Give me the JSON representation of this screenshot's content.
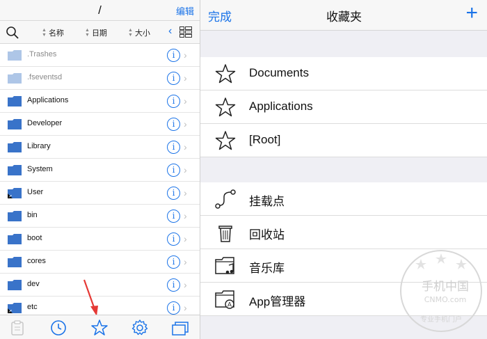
{
  "left": {
    "path": "/",
    "edit_label": "编辑",
    "sort": {
      "name": "名称",
      "date": "日期",
      "size": "大小"
    },
    "files": [
      {
        "name": ".Trashes",
        "dim": true
      },
      {
        "name": ".fseventsd",
        "dim": true
      },
      {
        "name": "Applications",
        "dim": false
      },
      {
        "name": "Developer",
        "dim": false
      },
      {
        "name": "Library",
        "dim": false
      },
      {
        "name": "System",
        "dim": false
      },
      {
        "name": "User",
        "dim": false,
        "alias": true
      },
      {
        "name": "bin",
        "dim": false
      },
      {
        "name": "boot",
        "dim": false
      },
      {
        "name": "cores",
        "dim": false
      },
      {
        "name": "dev",
        "dim": false
      },
      {
        "name": "etc",
        "dim": false,
        "alias": true
      }
    ],
    "tabs": [
      "clipboard-icon",
      "clock-icon",
      "star-icon",
      "gear-icon",
      "windows-icon"
    ]
  },
  "right": {
    "done_label": "完成",
    "title": "收藏夹",
    "add_label": "+",
    "favorites": [
      "Documents",
      "Applications",
      "[Root]"
    ],
    "locations": [
      "挂载点",
      "回收站",
      "音乐库",
      "App管理器"
    ]
  },
  "watermark": {
    "line1": "手机中国",
    "line2": "CNMO.com",
    "line3": "专业手机门户"
  },
  "colors": {
    "accent": "#1a73e8",
    "folder": "#3a73c9",
    "folder_dim": "#aec6e6",
    "grouped_bg": "#efeff4"
  }
}
